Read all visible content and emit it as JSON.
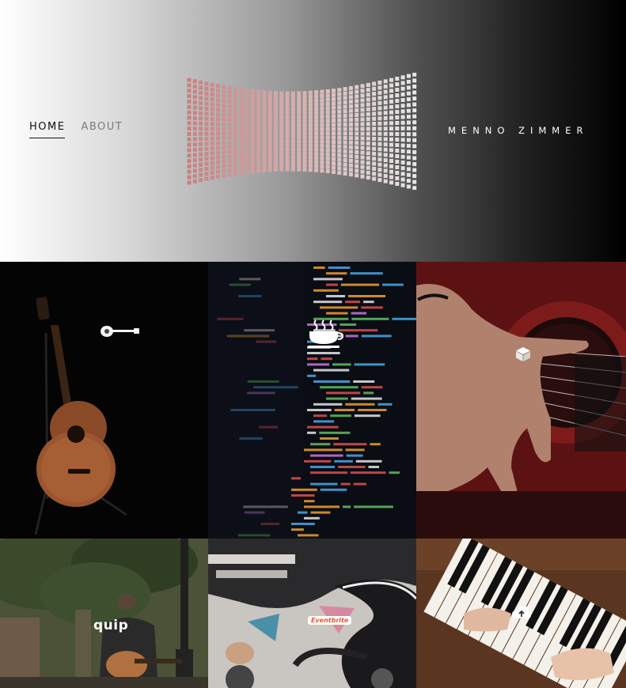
{
  "nav": {
    "home_label": "HOME",
    "about_label": "ABOUT"
  },
  "brand": {
    "name": "MENNO ZIMMER"
  },
  "colors": {
    "logo_left": "#c98080",
    "logo_right": "#e6e6e6",
    "active_underline": "#111111"
  },
  "tiles": [
    {
      "name": "acoustic-guitar",
      "icon": "guitar-icon"
    },
    {
      "name": "code-screen",
      "icon": "coffee-cup-icon"
    },
    {
      "name": "red-guitar-hand",
      "icon": "box-icon"
    },
    {
      "name": "guitarist-under-tree",
      "icon": "quip-logo",
      "icon_text": "quip"
    },
    {
      "name": "electric-guitar-picks",
      "icon": "eventbrite-logo",
      "icon_text": "Eventbrite"
    },
    {
      "name": "piano-hands",
      "icon": "cloud-upload-icon"
    }
  ]
}
